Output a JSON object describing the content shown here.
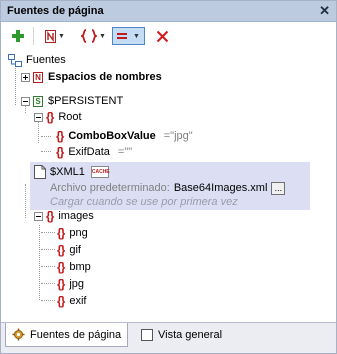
{
  "window": {
    "title": "Fuentes de página",
    "close_glyph": "✕"
  },
  "toolbar": {
    "buttons": [
      {
        "name": "add-source-button",
        "icon": "green-plus-icon"
      },
      {
        "name": "add-namespace-button",
        "icon": "namespace-n-icon"
      },
      {
        "name": "add-element-button",
        "icon": "braces-icon"
      },
      {
        "name": "add-parameter-button",
        "icon": "equals-icon"
      },
      {
        "name": "delete-button",
        "icon": "red-x-icon"
      }
    ],
    "dropdown_glyph": "▼"
  },
  "tree": {
    "root": {
      "label": "Fuentes"
    },
    "namespaces": {
      "icon_text": "N",
      "label": "Espacios de nombres"
    },
    "persistent": {
      "icon_text": "S",
      "label": "$PERSISTENT"
    },
    "root_node": {
      "icon": "{}",
      "label": "Root"
    },
    "combo": {
      "icon": "{}",
      "label": "ComboBoxValue",
      "value": "=\"jpg\""
    },
    "exif_data": {
      "icon": "{}",
      "label": "ExifData",
      "value": "=\"\""
    },
    "xml1": {
      "label": "$XML1",
      "cache_badge": "CACHE",
      "default_file_label": "Archivo predeterminado:",
      "default_file": "Base64Images.xml",
      "browse": "...",
      "load_hint": "Cargar cuando se use por primera vez"
    },
    "images": {
      "icon": "{}",
      "label": "images"
    },
    "children": [
      {
        "icon": "{}",
        "label": "png"
      },
      {
        "icon": "{}",
        "label": "gif"
      },
      {
        "icon": "{}",
        "label": "bmp"
      },
      {
        "icon": "{}",
        "label": "jpg"
      },
      {
        "icon": "{}",
        "label": "exif"
      }
    ]
  },
  "tabs": [
    {
      "label": "Fuentes de página",
      "active": true,
      "icon": "gear-icon"
    },
    {
      "label": "Vista general",
      "active": false,
      "icon": "overview-icon"
    }
  ]
}
